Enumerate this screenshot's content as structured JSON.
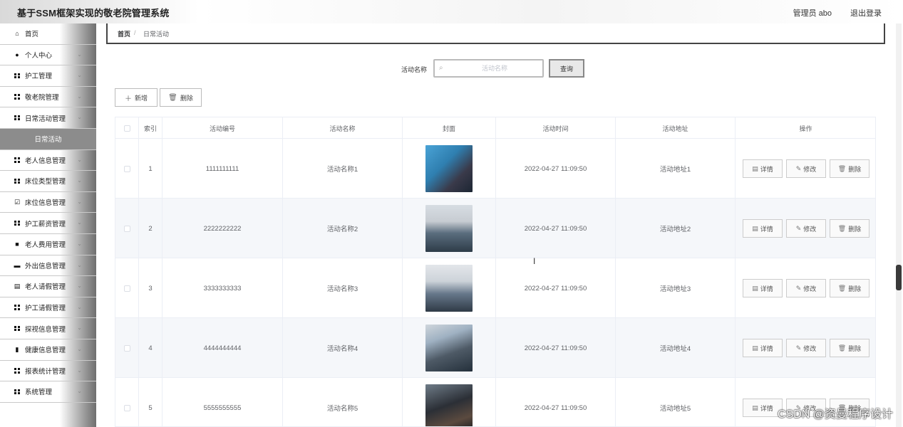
{
  "app": {
    "title": "基于SSM框架实现的敬老院管理系统",
    "user": "管理员 abo",
    "logout": "退出登录"
  },
  "sidebar": {
    "items": [
      {
        "label": "首页",
        "icon": "home-icon",
        "chevron": false
      },
      {
        "label": "个人中心",
        "icon": "user-icon",
        "chevron": true
      },
      {
        "label": "护工管理",
        "icon": "grid-icon",
        "chevron": true
      },
      {
        "label": "敬老院管理",
        "icon": "grid-icon",
        "chevron": true
      },
      {
        "label": "日常活动管理",
        "icon": "grid-icon",
        "chevron": true
      },
      {
        "label": "日常活动",
        "icon": "",
        "chevron": false,
        "active": true
      },
      {
        "label": "老人信息管理",
        "icon": "grid-icon",
        "chevron": true
      },
      {
        "label": "床位类型管理",
        "icon": "grid-icon",
        "chevron": true
      },
      {
        "label": "床位信息管理",
        "icon": "check-square-icon",
        "chevron": true
      },
      {
        "label": "护工薪资管理",
        "icon": "grid-icon",
        "chevron": true
      },
      {
        "label": "老人费用管理",
        "icon": "video-icon",
        "chevron": true
      },
      {
        "label": "外出信息管理",
        "icon": "briefcase-icon",
        "chevron": true
      },
      {
        "label": "老人请假管理",
        "icon": "clipboard-icon",
        "chevron": true
      },
      {
        "label": "护工请假管理",
        "icon": "grid-icon",
        "chevron": true
      },
      {
        "label": "探视信息管理",
        "icon": "grid-icon",
        "chevron": true
      },
      {
        "label": "健康信息管理",
        "icon": "bar-chart-icon",
        "chevron": true
      },
      {
        "label": "报表统计管理",
        "icon": "grid-icon",
        "chevron": true
      },
      {
        "label": "系统管理",
        "icon": "grid-icon",
        "chevron": true
      }
    ]
  },
  "breadcrumb": {
    "home": "首页",
    "separator": "/",
    "current": "日常活动"
  },
  "search": {
    "label": "活动名称",
    "placeholder": "活动名称",
    "value": "",
    "button": "查询"
  },
  "toolbar": {
    "add": "新增",
    "delete": "删除"
  },
  "table": {
    "headers": [
      "",
      "索引",
      "活动编号",
      "活动名称",
      "封面",
      "活动时间",
      "活动地址",
      "操作"
    ],
    "rows": [
      {
        "index": "1",
        "code": "1111111111",
        "name": "活动名称1",
        "time": "2022-04-27 11:09:50",
        "address": "活动地址1"
      },
      {
        "index": "2",
        "code": "2222222222",
        "name": "活动名称2",
        "time": "2022-04-27 11:09:50",
        "address": "活动地址2"
      },
      {
        "index": "3",
        "code": "3333333333",
        "name": "活动名称3",
        "time": "2022-04-27 11:09:50",
        "address": "活动地址3"
      },
      {
        "index": "4",
        "code": "4444444444",
        "name": "活动名称4",
        "time": "2022-04-27 11:09:50",
        "address": "活动地址4"
      },
      {
        "index": "5",
        "code": "5555555555",
        "name": "活动名称5",
        "time": "2022-04-27 11:09:50",
        "address": "活动地址5"
      }
    ],
    "actions": {
      "detail": "详情",
      "edit": "修改",
      "delete": "删除"
    }
  },
  "watermark": "CSDN @资曼程序设计",
  "colors": {
    "header_bg": "#f4f4f4",
    "sidebar_active": "#8c8c8c",
    "row_alt": "#f5f7fa",
    "border": "#ebeef5"
  }
}
